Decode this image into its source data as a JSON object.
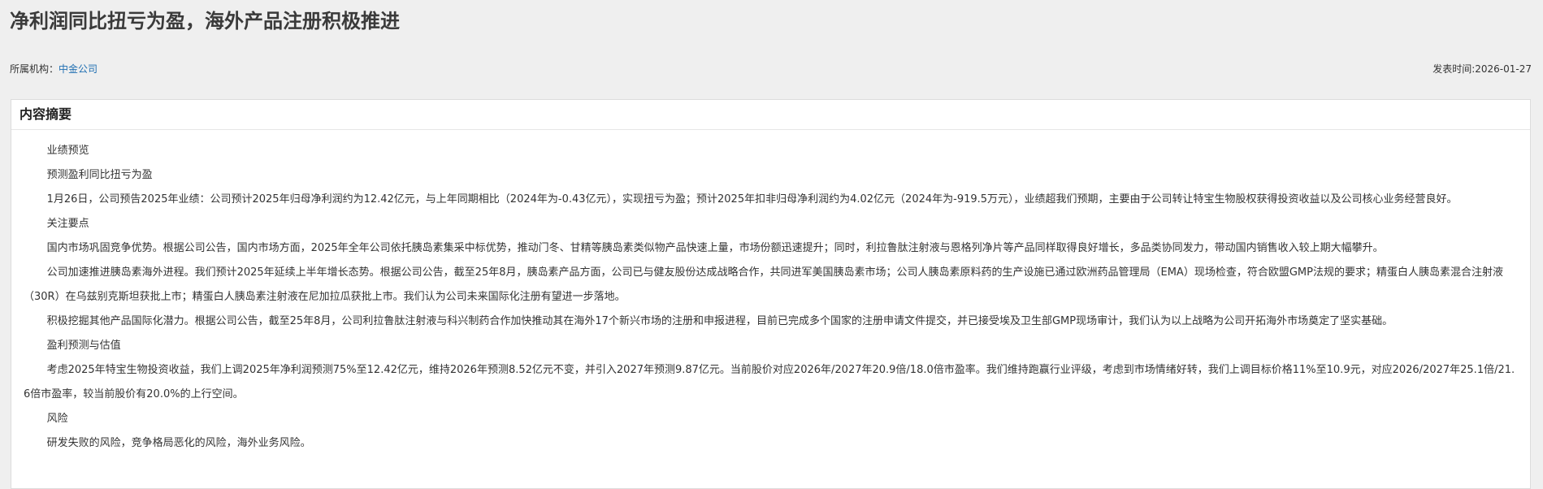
{
  "title": "净利润同比扭亏为盈，海外产品注册积极推进",
  "meta": {
    "org_label": "所属机构：",
    "org_name": "中金公司",
    "date_label": "发表时间:",
    "date_value": "2026-01-27"
  },
  "summary": {
    "heading": "内容摘要",
    "paragraphs": [
      "业绩预览",
      "预测盈利同比扭亏为盈",
      "1月26日，公司预告2025年业绩：公司预计2025年归母净利润约为12.42亿元，与上年同期相比（2024年为-0.43亿元），实现扭亏为盈；预计2025年扣非归母净利润约为4.02亿元（2024年为-919.5万元），业绩超我们预期，主要由于公司转让特宝生物股权获得投资收益以及公司核心业务经营良好。",
      "关注要点",
      "国内市场巩固竞争优势。根据公司公告，国内市场方面，2025年全年公司依托胰岛素集采中标优势，推动门冬、甘精等胰岛素类似物产品快速上量，市场份额迅速提升；同时，利拉鲁肽注射液与恩格列净片等产品同样取得良好增长，多品类协同发力，带动国内销售收入较上期大幅攀升。",
      "公司加速推进胰岛素海外进程。我们预计2025年延续上半年增长态势。根据公司公告，截至25年8月，胰岛素产品方面，公司已与健友股份达成战略合作，共同进军美国胰岛素市场；公司人胰岛素原料药的生产设施已通过欧洲药品管理局（EMA）现场检查，符合欧盟GMP法规的要求；精蛋白人胰岛素混合注射液（30R）在乌兹别克斯坦获批上市；精蛋白人胰岛素注射液在尼加拉瓜获批上市。我们认为公司未来国际化注册有望进一步落地。",
      "积极挖掘其他产品国际化潜力。根据公司公告，截至25年8月，公司利拉鲁肽注射液与科兴制药合作加快推动其在海外17个新兴市场的注册和申报进程，目前已完成多个国家的注册申请文件提交，并已接受埃及卫生部GMP现场审计，我们认为以上战略为公司开拓海外市场奠定了坚实基础。",
      "盈利预测与估值",
      "考虑2025年特宝生物投资收益，我们上调2025年净利润预测75%至12.42亿元，维持2026年预测8.52亿元不变，并引入2027年预测9.87亿元。当前股价对应2026年/2027年20.9倍/18.0倍市盈率。我们维持跑赢行业评级，考虑到市场情绪好转，我们上调目标价格11%至10.9元，对应2026/2027年25.1倍/21.6倍市盈率，较当前股价有20.0%的上行空间。",
      "风险",
      "研发失败的风险，竞争格局恶化的风险，海外业务风险。"
    ]
  }
}
